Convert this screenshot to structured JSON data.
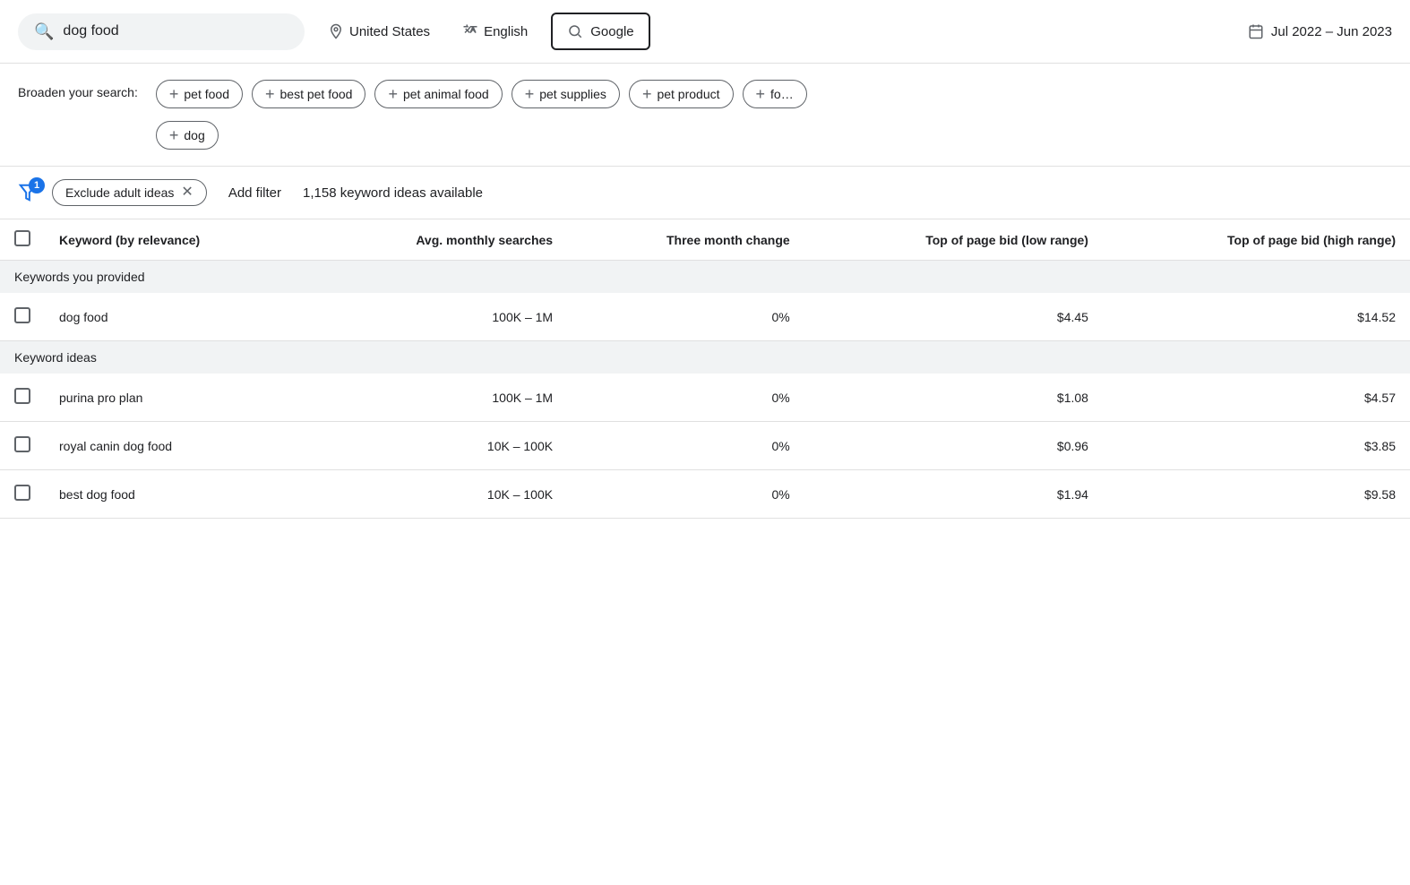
{
  "header": {
    "search_value": "dog food",
    "search_placeholder": "dog food",
    "location": "United States",
    "language": "English",
    "search_engine": "Google",
    "date_range": "Jul 2022 – Jun 2023"
  },
  "broaden": {
    "label": "Broaden your search:",
    "chips": [
      "pet food",
      "best pet food",
      "pet animal food",
      "pet supplies",
      "pet product",
      "fo..."
    ],
    "chips2": [
      "dog"
    ]
  },
  "filter_bar": {
    "badge": "1",
    "exclude_chip": "Exclude adult ideas",
    "add_filter": "Add filter",
    "keyword_count": "1,158 keyword ideas available"
  },
  "table": {
    "headers": [
      "",
      "Keyword (by relevance)",
      "Avg. monthly searches",
      "Three month change",
      "Top of page bid (low range)",
      "Top of page bid (high range)"
    ],
    "section1": "Keywords you provided",
    "section2": "Keyword ideas",
    "rows_provided": [
      {
        "keyword": "dog food",
        "avg_monthly": "100K – 1M",
        "three_month": "0%",
        "bid_low": "$4.45",
        "bid_high": "$14.52"
      }
    ],
    "rows_ideas": [
      {
        "keyword": "purina pro plan",
        "avg_monthly": "100K – 1M",
        "three_month": "0%",
        "bid_low": "$1.08",
        "bid_high": "$4.57"
      },
      {
        "keyword": "royal canin dog food",
        "avg_monthly": "10K – 100K",
        "three_month": "0%",
        "bid_low": "$0.96",
        "bid_high": "$3.85"
      },
      {
        "keyword": "best dog food",
        "avg_monthly": "10K – 100K",
        "three_month": "0%",
        "bid_low": "$1.94",
        "bid_high": "$9.58"
      }
    ]
  }
}
